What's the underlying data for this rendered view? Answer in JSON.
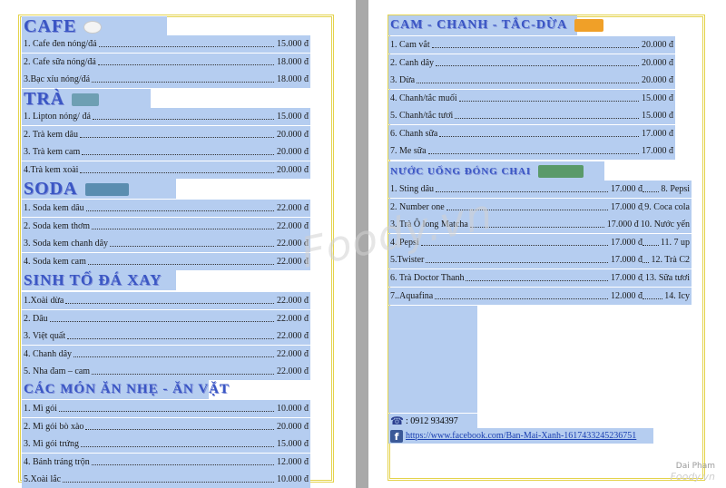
{
  "left_sections": [
    {
      "title": "CAFE",
      "icon": "coffee-cup-icon",
      "items": [
        {
          "name": "1. Cafe đen nóng/đá",
          "price": "15.000 đ"
        },
        {
          "name": "2. Cafe sữa nóng/đá",
          "price": "18.000 đ"
        },
        {
          "name": "3.Bạc xỉu nóng/đá",
          "price": "18.000 đ"
        }
      ]
    },
    {
      "title": "TRÀ",
      "icon": "tea-glasses-icon",
      "items": [
        {
          "name": "1. Lipton nóng/ đá",
          "price": "15.000 đ"
        },
        {
          "name": "2. Trà kem dâu",
          "price": "20.000 đ"
        },
        {
          "name": "3. Trà kem cam",
          "price": "20.000 đ"
        },
        {
          "name": "4.Trà kem xoài",
          "price": "20.000 đ"
        }
      ]
    },
    {
      "title": "SODA",
      "icon": "soda-glasses-icon",
      "items": [
        {
          "name": "1. Soda kem dâu",
          "price": "22.000 đ"
        },
        {
          "name": "2. Soda kem thơm",
          "price": "22.000 đ"
        },
        {
          "name": "3. Soda kem chanh dây",
          "price": "22.000 đ"
        },
        {
          "name": "4. Soda kem cam",
          "price": "22.000 đ"
        }
      ]
    },
    {
      "title": "SINH TỐ ĐÁ XAY",
      "icon": "",
      "items": [
        {
          "name": "1.Xoài dừa",
          "price": "22.000 đ"
        },
        {
          "name": "2. Dâu",
          "price": "22.000 đ"
        },
        {
          "name": "3. Việt quất",
          "price": "22.000 đ"
        },
        {
          "name": "4. Chanh dây",
          "price": "22.000 đ"
        },
        {
          "name": "5. Nha đam – cam",
          "price": "22.000 đ"
        }
      ]
    },
    {
      "title": "CÁC MÓN ĂN NHẸ - ĂN VẶT",
      "icon": "",
      "items": [
        {
          "name": "1. Mì gói",
          "price": "10.000 đ"
        },
        {
          "name": "2. Mì gói bò xào",
          "price": "20.000 đ"
        },
        {
          "name": "3. Mì gói trứng",
          "price": "15.000 đ"
        },
        {
          "name": "4. Bánh tráng trộn",
          "price": "12.000 đ"
        },
        {
          "name": "5.Xoài lắc",
          "price": "10.000 đ"
        }
      ]
    }
  ],
  "right_section": {
    "title": "CAM - CHANH - TẮC-DỪA",
    "icon": "fruit-icon",
    "items": [
      {
        "name": "1. Cam vắt",
        "price": "20.000 đ"
      },
      {
        "name": "2. Canh dây",
        "price": "20.000 đ"
      },
      {
        "name": "3. Dừa",
        "price": "20.000 đ"
      },
      {
        "name": "4. Chanh/tắc muối",
        "price": "15.000 đ"
      },
      {
        "name": "5. Chanh/tắc tươi",
        "price": "15.000 đ"
      },
      {
        "name": "6. Chanh sữa",
        "price": "17.000 đ"
      },
      {
        "name": "7. Me sữa",
        "price": "17.000 đ"
      }
    ]
  },
  "bottled_section": {
    "title": "NƯỚC UỐNG ĐÓNG CHAI",
    "icon": "bottles-icon",
    "rows": [
      {
        "name": "1. Sting dâu",
        "price": "17.000 đ",
        "right": "8. Pepsi"
      },
      {
        "name": "2. Number one",
        "price": "17.000 đ",
        "right": "9. Coca cola"
      },
      {
        "name": "3. Trà Ô long Matcha",
        "price": "17.000 đ",
        "right": "10. Nước yến"
      },
      {
        "name": "4. Pepsi",
        "price": "17.000 đ",
        "right": "11. 7 up"
      },
      {
        "name": "5.Twister",
        "price": "17.000 đ",
        "right": "12. Trà C2"
      },
      {
        "name": "6. Trà Doctor Thanh",
        "price": "17.000 đ",
        "right": "13. Sữa tươi"
      },
      {
        "name": "7..Aquafina",
        "price": "12.000 đ",
        "right": "14. Icy"
      }
    ]
  },
  "contact": {
    "phone": ": 0912 934397",
    "phone_icon": "telephone-icon",
    "facebook_url": "https://www.facebook.com/Ban-Mai-Xanh-1617433245236751",
    "facebook_icon": "facebook-icon"
  },
  "watermark": "Foody.vn",
  "credit": {
    "author": "Dai Pham",
    "brand": "Foody.vn"
  },
  "colors": {
    "highlight": "#b5cdf0",
    "title": "#3a56c4",
    "border": "#e4d34c"
  }
}
